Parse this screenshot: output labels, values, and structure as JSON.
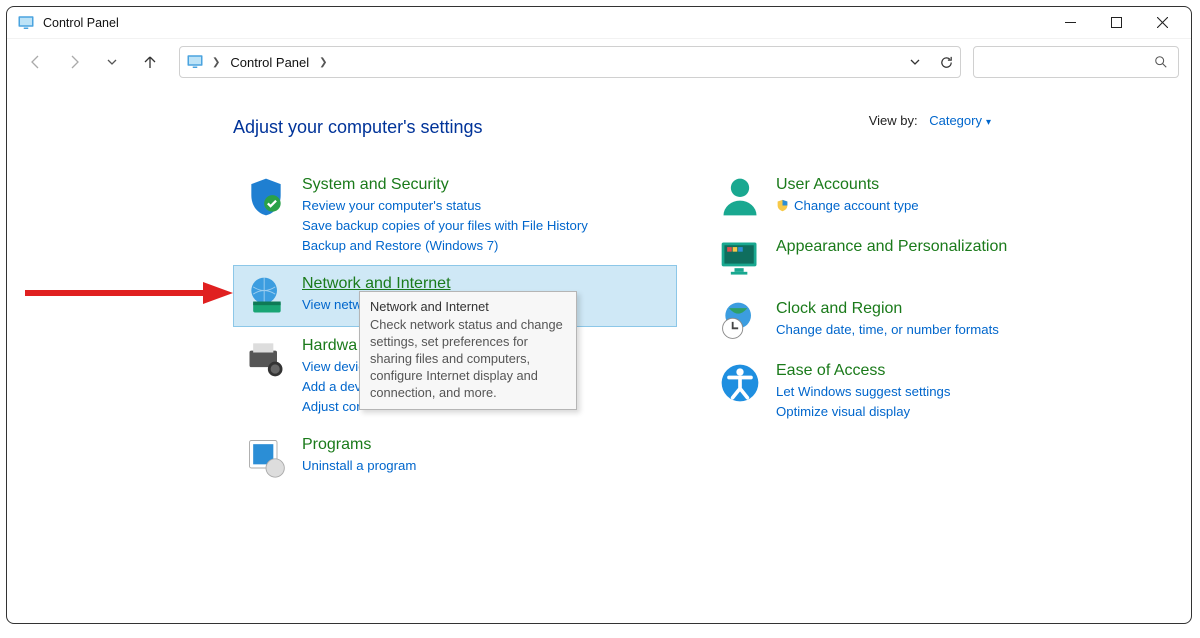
{
  "window": {
    "title": "Control Panel"
  },
  "breadcrumb": {
    "item": "Control Panel"
  },
  "heading": "Adjust your computer's settings",
  "viewby": {
    "label": "View by:",
    "value": "Category"
  },
  "left": [
    {
      "key": "system-security",
      "title": "System and Security",
      "links": [
        "Review your computer's status",
        "Save backup copies of your files with File History",
        "Backup and Restore (Windows 7)"
      ]
    },
    {
      "key": "network-internet",
      "title": "Network and Internet",
      "links": [
        "View netw"
      ]
    },
    {
      "key": "hardware-sound",
      "title": "Hardwa",
      "links": [
        "View devic",
        "Add a devi",
        "Adjust cor"
      ]
    },
    {
      "key": "programs",
      "title": "Programs",
      "links": [
        "Uninstall a program"
      ]
    }
  ],
  "right": [
    {
      "key": "user-accounts",
      "title": "User Accounts",
      "links": [
        "Change account type"
      ],
      "shield": [
        true
      ]
    },
    {
      "key": "appearance",
      "title": "Appearance and Personalization",
      "links": []
    },
    {
      "key": "clock-region",
      "title": "Clock and Region",
      "links": [
        "Change date, time, or number formats"
      ]
    },
    {
      "key": "ease-access",
      "title": "Ease of Access",
      "links": [
        "Let Windows suggest settings",
        "Optimize visual display"
      ]
    }
  ],
  "tooltip": {
    "title": "Network and Internet",
    "body": "Check network status and change settings, set preferences for sharing files and computers, configure Internet display and connection, and more."
  }
}
